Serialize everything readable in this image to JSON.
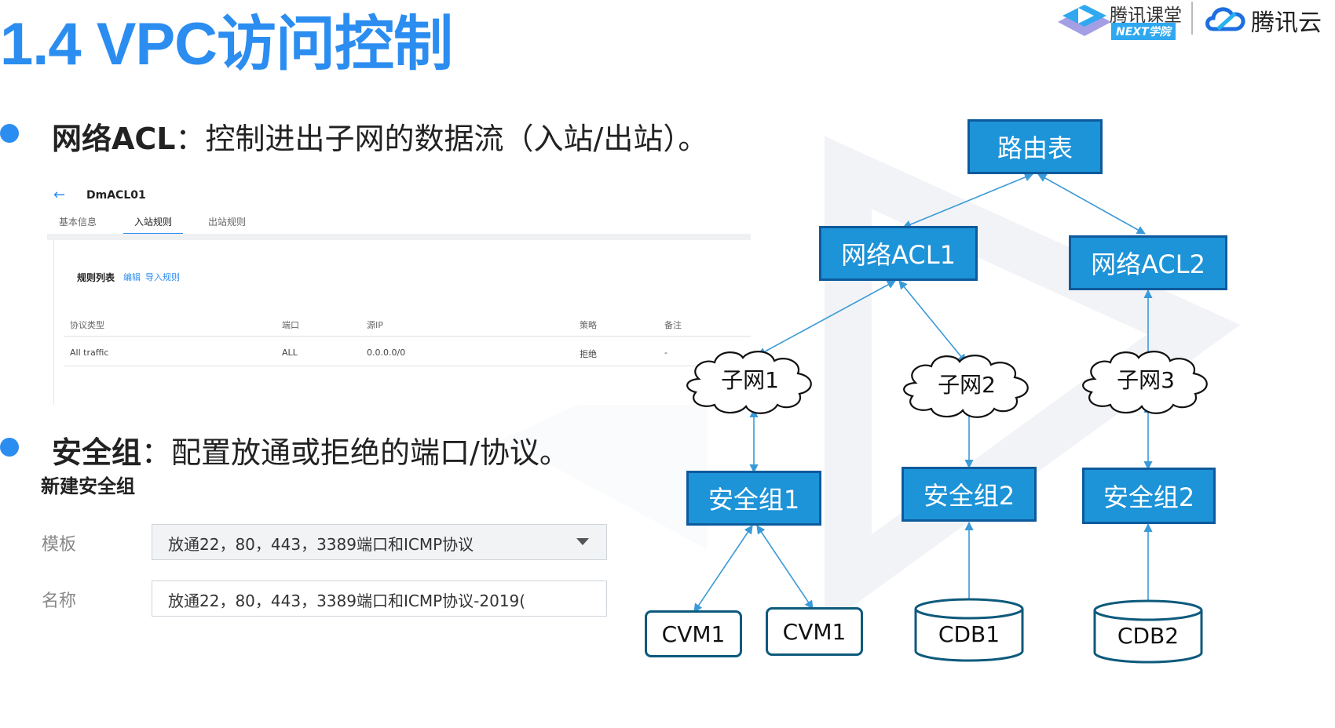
{
  "slide": {
    "title": "1.4 VPC访问控制"
  },
  "logos": {
    "a_name": "腾讯课堂",
    "a_sub": "NEXT学院",
    "b_name": "腾讯云"
  },
  "bullets": [
    {
      "term": "网络ACL",
      "text": "：控制进出子网的数据流（入站/出站）。"
    },
    {
      "term": "安全组",
      "text": "：配置放通或拒绝的端口/协议。"
    }
  ],
  "acl_console": {
    "name": "DmACL01",
    "tabs": [
      "基本信息",
      "入站规则",
      "出站规则"
    ],
    "active_tab": "入站规则",
    "rule_list_title": "规则列表",
    "actions": [
      "编辑",
      "导入规则"
    ],
    "columns": [
      "协议类型",
      "端口",
      "源IP",
      "策略",
      "备注"
    ],
    "rows": [
      [
        "All traffic",
        "ALL",
        "0.0.0.0/0",
        "拒绝",
        "-"
      ]
    ]
  },
  "security_group_form": {
    "title": "新建安全组",
    "template_label": "模板",
    "template_value": "放通22，80，443，3389端口和ICMP协议",
    "name_label": "名称",
    "name_value": "放通22，80，443，3389端口和ICMP协议-2019("
  },
  "diagram": {
    "route_table": "路由表",
    "acl1": "网络ACL1",
    "acl2": "网络ACL2",
    "subnet1": "子网1",
    "subnet2": "子网2",
    "subnet3": "子网3",
    "sg1": "安全组1",
    "sg2a": "安全组2",
    "sg2b": "安全组2",
    "cvm1a": "CVM1",
    "cvm1b": "CVM1",
    "cdb1": "CDB1",
    "cdb2": "CDB2"
  },
  "colors": {
    "title_blue": "#2c8df0",
    "node_blue": "#1d93d8",
    "node_border": "#0d5a9c"
  }
}
